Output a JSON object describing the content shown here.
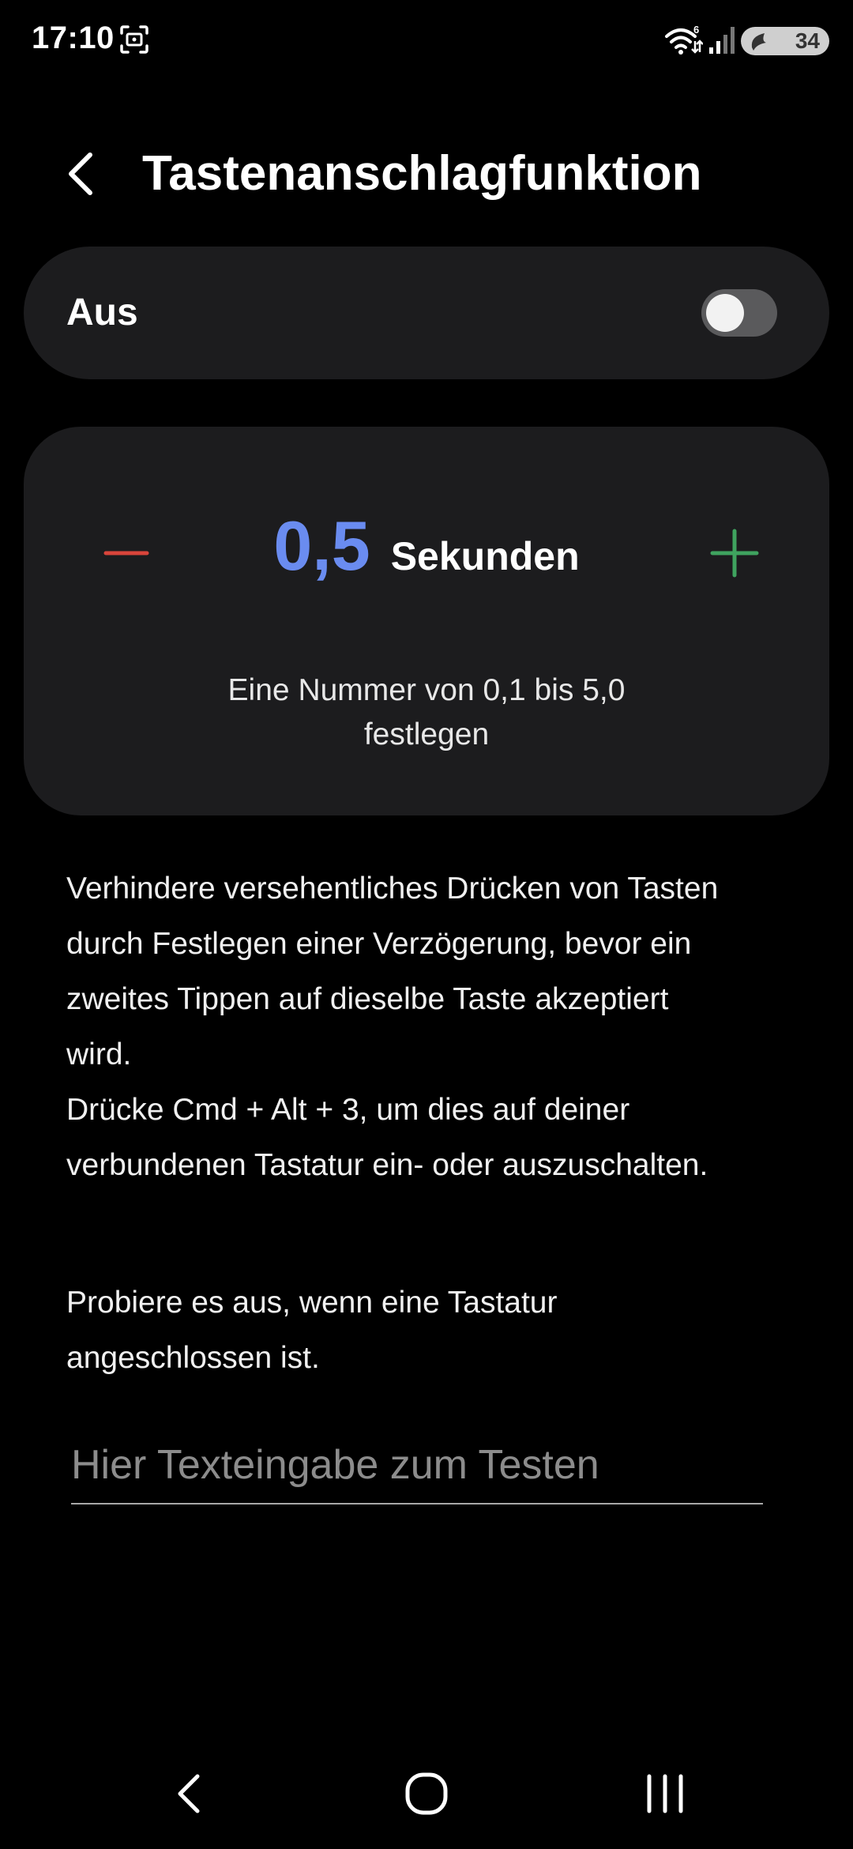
{
  "status_bar": {
    "time": "17:10",
    "wifi_badge": "6",
    "battery_level": "34",
    "icons": [
      "screenshot-icon",
      "wifi-icon",
      "signal-icon",
      "battery-charging-icon"
    ]
  },
  "header": {
    "title": "Tastenanschlagfunktion",
    "back_icon": "chevron-left-icon"
  },
  "toggle": {
    "label": "Aus",
    "state": "off"
  },
  "stepper": {
    "value": "0,5",
    "unit": "Sekunden",
    "hint_line1": "Eine Nummer von 0,1 bis 5,0",
    "hint_line2": "festlegen",
    "minus_icon": "minus-icon",
    "plus_icon": "plus-icon",
    "colors": {
      "value": "#6a8cf0",
      "minus": "#d9453b",
      "plus": "#3fa35f"
    }
  },
  "description": {
    "lines": [
      "Verhindere versehentliches Drücken von Tasten",
      "durch Festlegen einer Verzögerung, bevor ein",
      "zweites Tippen auf dieselbe Taste akzeptiert",
      "wird.",
      "Drücke Cmd + Alt + 3, um dies auf deiner",
      "verbundenen Tastatur ein- oder auszuschalten."
    ]
  },
  "try_it": {
    "lines": [
      "Probiere es aus, wenn eine Tastatur",
      "angeschlossen ist."
    ],
    "input_placeholder": "Hier Texteingabe zum Testen",
    "input_value": ""
  },
  "nav_bar": {
    "icons": [
      "nav-back-icon",
      "nav-home-icon",
      "nav-recents-icon"
    ]
  }
}
